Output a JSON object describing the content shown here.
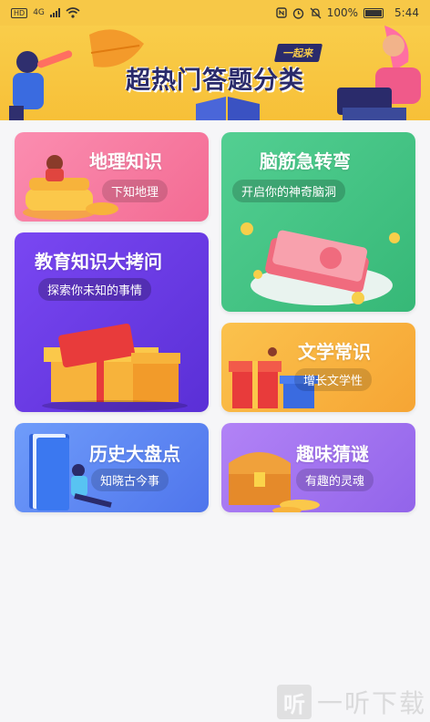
{
  "status_bar": {
    "network_badge": "HD",
    "network_type": "4G",
    "battery": "100%",
    "time": "5:44",
    "icons": [
      "hd-icon",
      "signal-icon",
      "wifi-icon",
      "nfc-icon",
      "alarm-icon",
      "mute-icon",
      "battery-icon"
    ]
  },
  "banner": {
    "tag": "一起来",
    "title": "超热门答题分类"
  },
  "categories": [
    {
      "title": "地理知识",
      "subtitle": "下知地理",
      "color": "#f7749b",
      "icon": "coins-person-illustration"
    },
    {
      "title": "脑筋急转弯",
      "subtitle": "开启你的神奇脑洞",
      "color": "#46c788",
      "icon": "money-stack-illustration"
    },
    {
      "title": "教育知识大拷问",
      "subtitle": "探索你未知的事情",
      "color": "#6b3de8",
      "icon": "gift-box-illustration"
    },
    {
      "title": "文学常识",
      "subtitle": "增长文学性",
      "color": "#f7b63c",
      "icon": "gift-box-illustration"
    },
    {
      "title": "历史大盘点",
      "subtitle": "知晓古今事",
      "color": "#5f8bf6",
      "icon": "book-reader-illustration"
    },
    {
      "title": "趣味猜谜",
      "subtitle": "有趣的灵魂",
      "color": "#a574f2",
      "icon": "treasure-chest-illustration"
    }
  ],
  "watermark": {
    "logo": "听",
    "text": "一听下载"
  }
}
